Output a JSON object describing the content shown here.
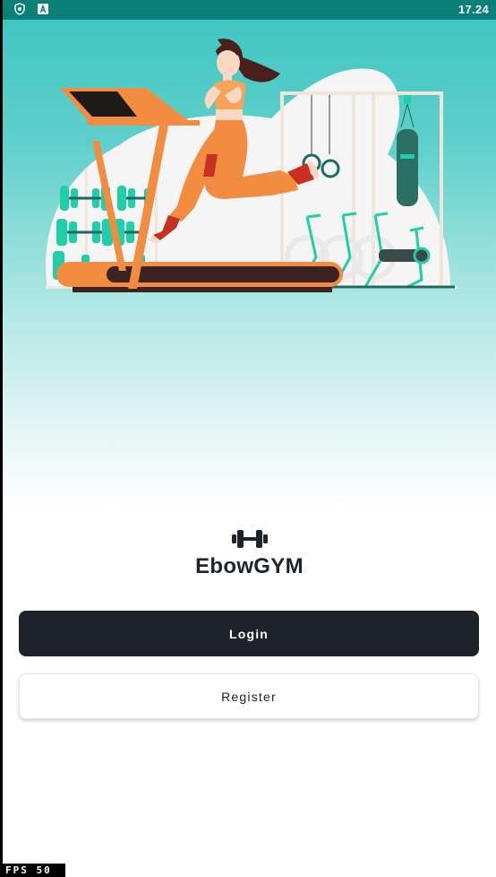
{
  "status_bar": {
    "time": "17.24",
    "icons": [
      "shield-app-icon",
      "a-app-icon"
    ]
  },
  "hero": {
    "illustration": "woman-running-on-treadmill-in-gym",
    "colors": {
      "teal": "#41c6c2",
      "orange": "#f28c41",
      "dark": "#3a2320",
      "equipment_green": "#1ecfa8"
    }
  },
  "brand": {
    "logo_icon": "dumbbell-icon",
    "app_name": "EbowGYM"
  },
  "actions": {
    "login_label": "Login",
    "register_label": "Register"
  },
  "debug": {
    "fps_label": "FPS 50"
  },
  "theme": {
    "primary": "#1e222b",
    "background": "#ffffff"
  }
}
